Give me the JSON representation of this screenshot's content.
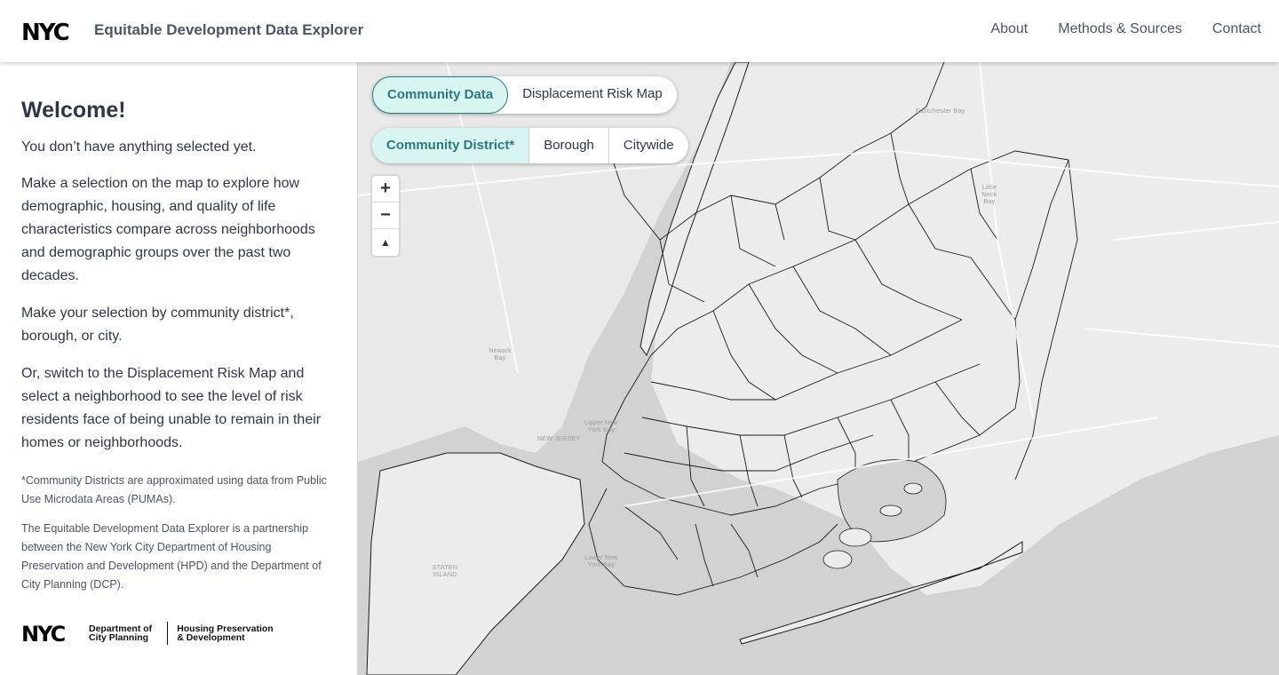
{
  "header": {
    "logo_text": "NYC",
    "title": "Equitable Development Data Explorer",
    "nav": [
      "About",
      "Methods & Sources",
      "Contact"
    ]
  },
  "sidebar": {
    "heading": "Welcome!",
    "p1": "You don’t have anything selected yet.",
    "p2": "Make a selection on the map to explore how demographic, housing, and quality of life characteristics compare across neighborhoods and demographic groups over the past two decades.",
    "p3": "Make your selection by community district*, borough, or city.",
    "p4": "Or, switch to the Displacement Risk Map and select a neighborhood to see the level of risk residents face of being unable to remain in their homes or neighborhoods.",
    "note1": "*Community Districts are approximated using data from Public Use Microdata Areas (PUMAs).",
    "note2": "The Equitable Development Data Explorer is a partnership between the New York City Department of Housing Preservation and Development (HPD) and the Department of City Planning (DCP).",
    "footer": {
      "dcp_line1": "Department of",
      "dcp_line2": "City Planning",
      "hpd_line1": "Housing Preservation",
      "hpd_line2": "& Development"
    }
  },
  "map": {
    "mode_toggle": [
      "Community Data",
      "Displacement Risk Map"
    ],
    "mode_active": "Community Data",
    "geography": [
      "Community District*",
      "Borough",
      "Citywide"
    ],
    "geography_active": "Community District*",
    "zoom": {
      "in": "+",
      "out": "−",
      "compass": "▲"
    },
    "labels": {
      "eastchester": "Eastchester Bay",
      "little_neck": "Little Neck Bay",
      "newark": "Newark Bay",
      "upper_ny": "Upper New York Bay",
      "new_jersey": "NEW JERSEY",
      "lower_ny": "Lower New York Bay",
      "staten": "STATEN ISLAND"
    },
    "colors": {
      "water": "#d2d2d2",
      "land": "#ececec",
      "border": "#1a1a1a",
      "accent": "#2c7a7b",
      "accent_bg": "#d8f5f1"
    }
  }
}
